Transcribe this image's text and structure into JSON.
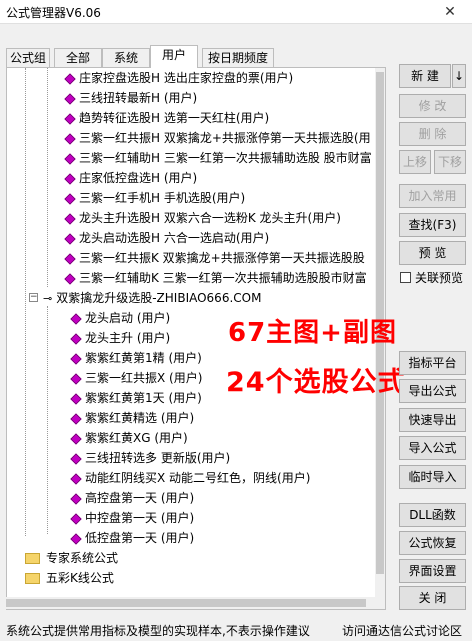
{
  "window": {
    "title": "公式管理器V6.06",
    "close_glyph": "✕"
  },
  "tabs": [
    {
      "label": "公式组"
    },
    {
      "label": "全部"
    },
    {
      "label": "系统"
    },
    {
      "label": "用户"
    },
    {
      "label": "按日期频度"
    }
  ],
  "tree": {
    "items_top": [
      {
        "label": "庄家控盘选股H  选出庄家控盘的票(用户)"
      },
      {
        "label": "三线扭转最新H  (用户)"
      },
      {
        "label": "趋势转征选股H  选第一天红柱(用户)"
      },
      {
        "label": "三紫一红共振H  双紫擒龙+共振涨停第一天共振选股(用"
      },
      {
        "label": "三紫一红辅助H  三紫一红第一次共振辅助选股 股市财富"
      },
      {
        "label": "庄家低控盘选H  (用户)"
      },
      {
        "label": "三紫一红手机H  手机选股(用户)"
      },
      {
        "label": "龙头主升选股H  双紫六合一选粉K 龙头主升(用户)"
      },
      {
        "label": "龙头启动选股H  六合一选启动(用户)"
      },
      {
        "label": "三紫一红共振K  双紫擒龙+共振涨停第一天共振选股股"
      },
      {
        "label": "三紫一红辅助K  三紫一红第一次共振辅助选股股市财富"
      }
    ],
    "group": {
      "label": "双紫擒龙升级选股-ZHIBIAO666.COM"
    },
    "items_group": [
      {
        "label": "龙头启动  (用户)"
      },
      {
        "label": "龙头主升  (用户)"
      },
      {
        "label": "紫紫红黄第1精  (用户)"
      },
      {
        "label": "三紫一红共振X  (用户)"
      },
      {
        "label": "紫紫红黄第1天  (用户)"
      },
      {
        "label": "紫紫红黄精选  (用户)"
      },
      {
        "label": "紫紫红黄XG  (用户)"
      },
      {
        "label": "三线扭转选多  更新版(用户)"
      },
      {
        "label": "动能红阴线买X  动能二号红色，阴线(用户)"
      },
      {
        "label": "高控盘第一天  (用户)"
      },
      {
        "label": "中控盘第一天  (用户)"
      },
      {
        "label": "低控盘第一天  (用户)"
      }
    ],
    "folders": [
      {
        "label": "专家系统公式"
      },
      {
        "label": "五彩K线公式"
      }
    ]
  },
  "overlay": {
    "line1": "67主图+副图",
    "line2": "24个选股公式"
  },
  "buttons": {
    "new": "新  建",
    "new_arrow": "↓",
    "modify": "修  改",
    "delete": "删  除",
    "move_up": "上移",
    "move_down": "下移",
    "add_common": "加入常用",
    "find": "查找(F3)",
    "preview": "预  览",
    "link_preview": "关联预览",
    "indicator_platform": "指标平台",
    "export": "导出公式",
    "quick_export": "快速导出",
    "import": "导入公式",
    "temp_import": "临时导入",
    "dll": "DLL函数",
    "restore": "公式恢复",
    "ui_settings": "界面设置",
    "close": "关  闭"
  },
  "status": {
    "left": "系统公式提供常用指标及模型的实现样本,不表示操作建议",
    "right": "访问通达信公式讨论区"
  }
}
